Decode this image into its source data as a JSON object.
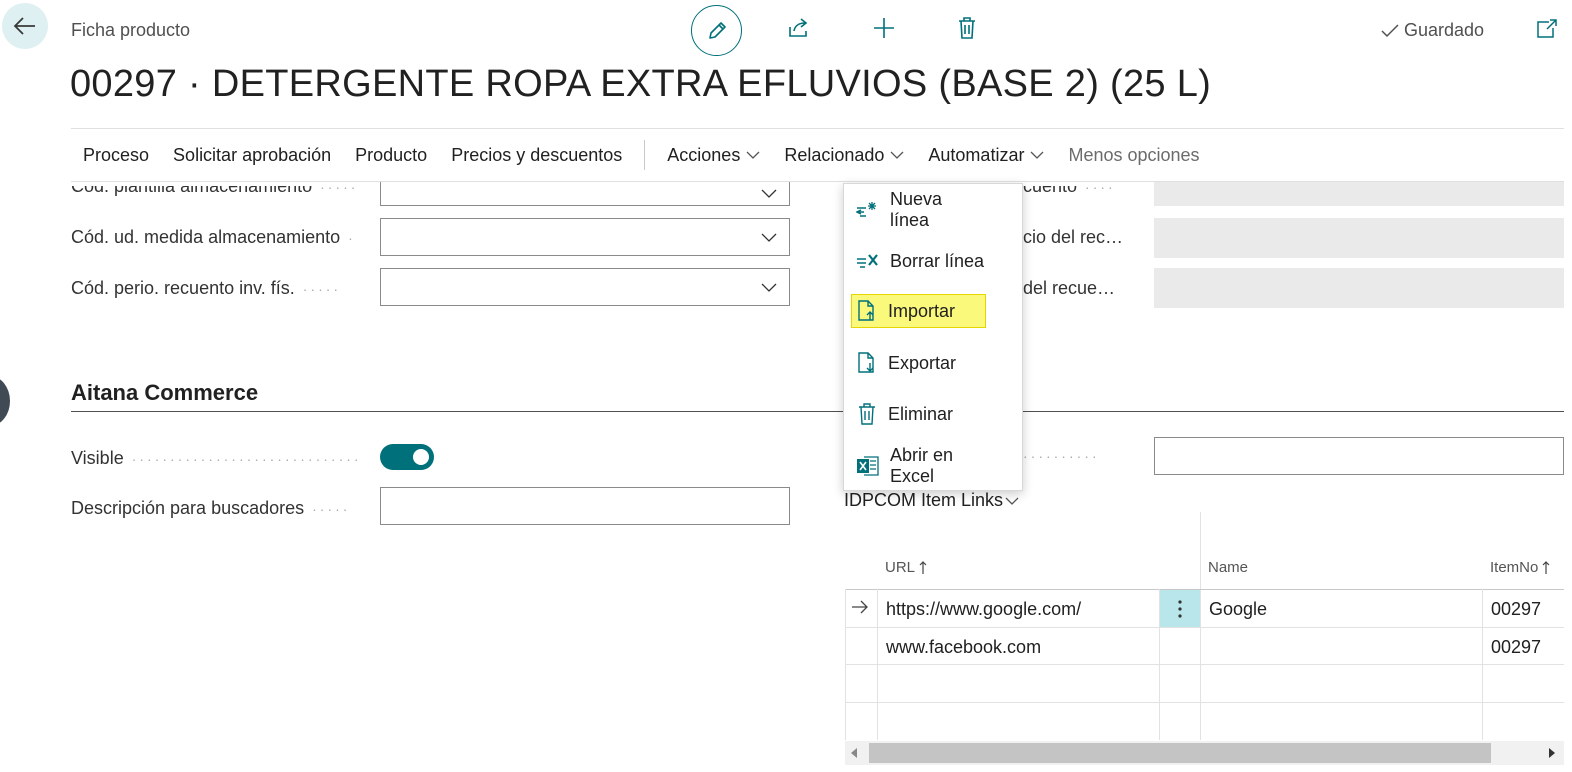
{
  "header": {
    "breadcrumb": "Ficha producto",
    "title": "00297 · DETERGENTE ROPA EXTRA EFLUVIOS (BASE 2) (25 L)",
    "saved_status": "Guardado",
    "icons": [
      "back-arrow-icon",
      "pencil-icon",
      "share-icon",
      "plus-icon",
      "trash-icon",
      "checkmark-icon",
      "popout-icon"
    ]
  },
  "actionbar": {
    "items": [
      "Proceso",
      "Solicitar aprobación",
      "Producto",
      "Precios y descuentos"
    ],
    "dropdowns": [
      "Acciones",
      "Relacionado",
      "Automatizar"
    ],
    "less_options": "Menos opciones"
  },
  "fields_top": {
    "storage_template": "Cód. plantilla almacenamiento",
    "storage_uom": "Cód. ud. medida almacenamiento",
    "phys_count_period": "Cód. perio. recuento inv. fís.",
    "right_1": "cuento",
    "right_2": "cio del rec…",
    "right_3": "del recue…"
  },
  "section": {
    "title": "Aitana Commerce",
    "visible_label": "Visible",
    "visible_value": true,
    "seo_label": "Descripción para buscadores",
    "seo_value": ""
  },
  "menu": {
    "items": [
      {
        "label": "Nueva línea",
        "icon": "new-line-icon"
      },
      {
        "label": "Borrar línea",
        "icon": "delete-line-icon"
      },
      {
        "label": "Importar",
        "icon": "import-icon",
        "highlighted": true
      },
      {
        "label": "Exportar",
        "icon": "export-icon"
      },
      {
        "label": "Eliminar",
        "icon": "trash-icon"
      },
      {
        "label": "Abrir en Excel",
        "icon": "excel-icon"
      }
    ]
  },
  "links": {
    "title": "IDPCOM Item Links",
    "columns": [
      "URL",
      "Name",
      "ItemNo"
    ],
    "rows": [
      {
        "url": "https://www.google.com/",
        "name": "Google",
        "item_no": "00297"
      },
      {
        "url": "www.facebook.com",
        "name": "",
        "item_no": "00297"
      }
    ]
  },
  "colors": {
    "accent": "#00707a",
    "highlight": "#fbf97c",
    "selected_cell": "#b8e6ea"
  }
}
